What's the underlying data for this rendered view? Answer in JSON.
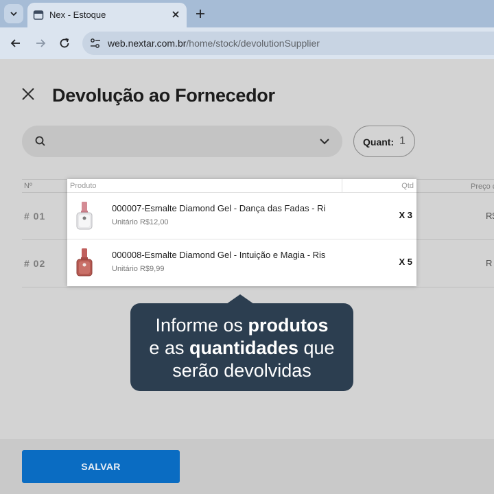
{
  "browser": {
    "tab_title": "Nex - Estoque",
    "url_host": "web.nextar.com.br",
    "url_path": "/home/stock/devolutionSupplier"
  },
  "page": {
    "title": "Devolução ao Fornecedor",
    "quant_label": "Quant:",
    "quant_value": "1"
  },
  "table": {
    "headers": {
      "no": "Nº",
      "produto": "Produto",
      "qtd": "Qtd",
      "preco": "Preço c"
    },
    "rows": [
      {
        "num": "# 01",
        "name": "000007-Esmalte Diamond Gel - Dança das Fadas - Ri",
        "unit": "Unitário R$12,00",
        "qty": "X 3",
        "price": "R$"
      },
      {
        "num": "# 02",
        "name": "000008-Esmalte Diamond Gel - Intuição e Magia - Ris",
        "unit": "Unitário R$9,99",
        "qty": "X 5",
        "price": "R"
      }
    ]
  },
  "tooltip": {
    "line1_pre": "Informe os ",
    "line1_bold": "produtos",
    "line2_pre": "e as ",
    "line2_bold": "quantidades",
    "line2_post": " que",
    "line3": "serão devolvidas"
  },
  "footer": {
    "save_label": "SALVAR"
  },
  "colors": {
    "primary": "#0a6cc2",
    "tooltip_bg": "#2c3e50",
    "polish_1": "#d98a96",
    "polish_2": "#b5524a"
  }
}
